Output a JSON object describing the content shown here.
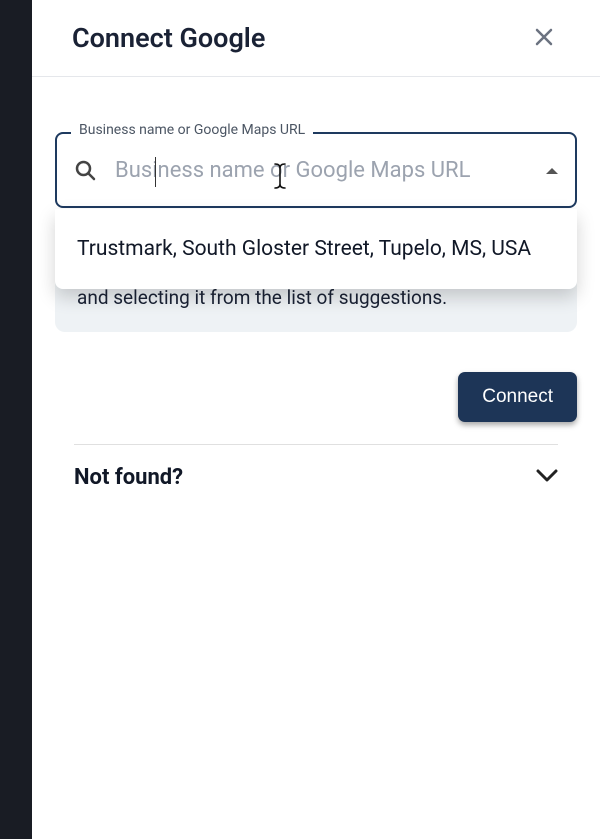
{
  "header": {
    "title": "Connect Google"
  },
  "search": {
    "label": "Business name or Google Maps URL",
    "placeholder": "Business name or Google Maps URL",
    "value": "",
    "suggestion": "Trustmark, South Gloster Street, Tupelo, MS, USA"
  },
  "hint": {
    "text_visible": "and selecting it from the list of suggestions."
  },
  "actions": {
    "connect_label": "Connect"
  },
  "accordion": {
    "not_found_label": "Not found?"
  }
}
